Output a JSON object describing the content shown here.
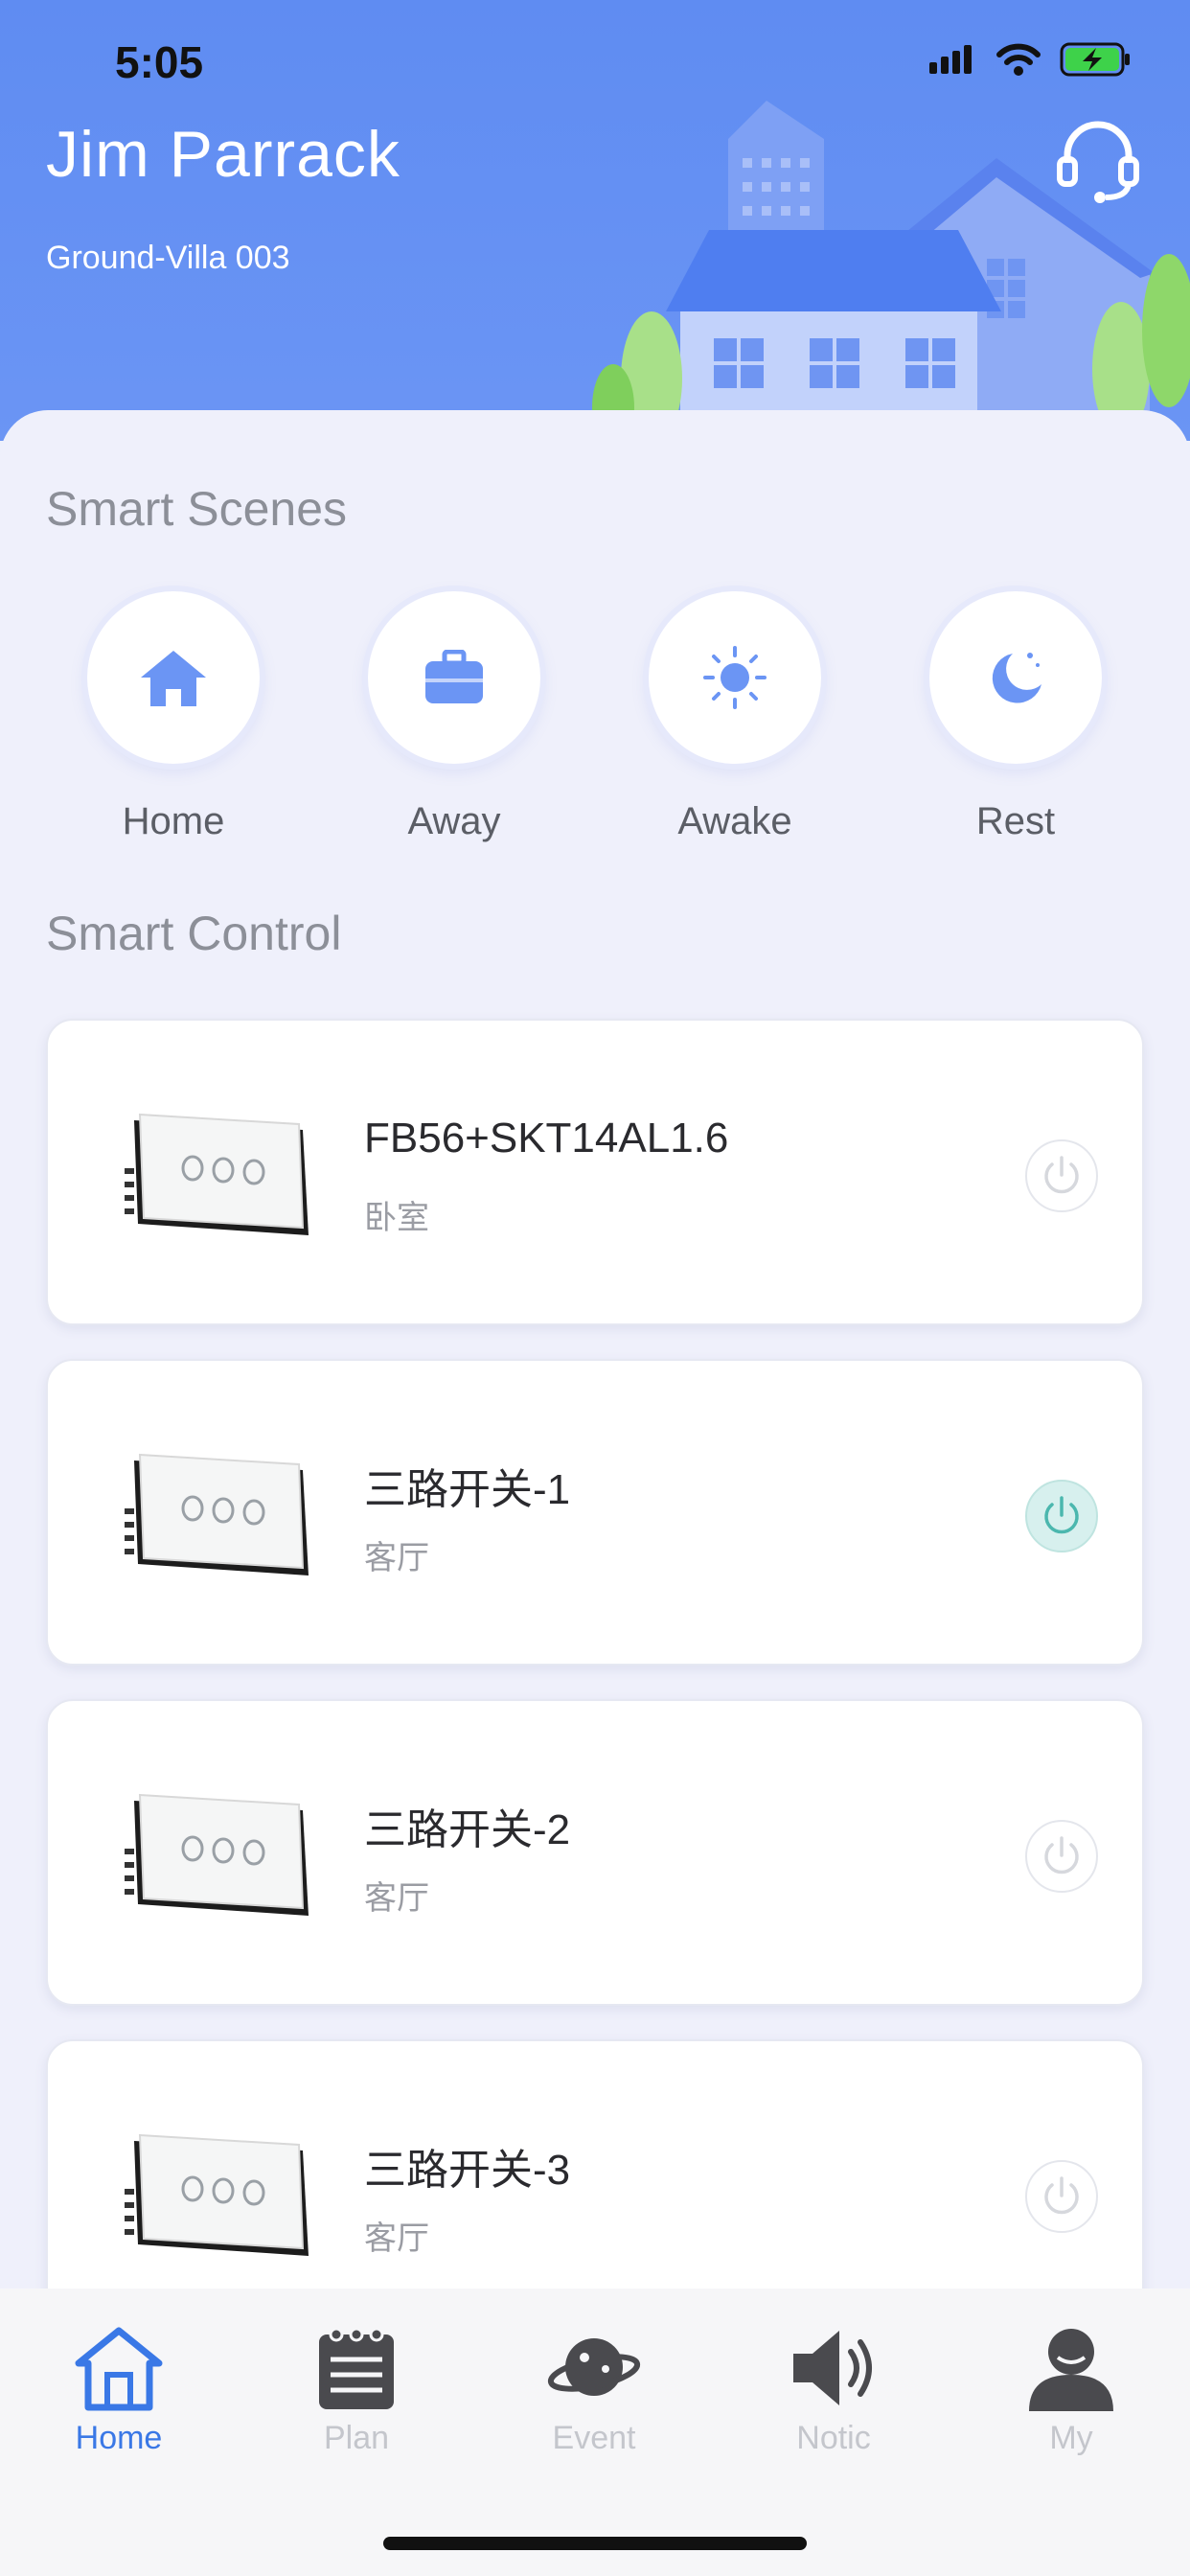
{
  "status_bar": {
    "time": "5:05"
  },
  "header": {
    "user_name": "Jim Parrack",
    "location": "Ground-Villa 003",
    "support_icon": "headset-icon"
  },
  "smart_scenes": {
    "title": "Smart Scenes",
    "items": [
      {
        "label": "Home",
        "icon": "home-icon"
      },
      {
        "label": "Away",
        "icon": "briefcase-icon"
      },
      {
        "label": "Awake",
        "icon": "sun-icon"
      },
      {
        "label": "Rest",
        "icon": "moon-icon"
      }
    ]
  },
  "smart_control": {
    "title": "Smart Control",
    "devices": [
      {
        "name": "FB56+SKT14AL1.6",
        "room": "卧室",
        "power_on": false
      },
      {
        "name": "三路开关-1",
        "room": "客厅",
        "power_on": true
      },
      {
        "name": "三路开关-2",
        "room": "客厅",
        "power_on": false
      },
      {
        "name": "三路开关-3",
        "room": "客厅",
        "power_on": false
      }
    ]
  },
  "tab_bar": {
    "items": [
      {
        "label": "Home",
        "icon": "home-outline-icon",
        "active": true
      },
      {
        "label": "Plan",
        "icon": "notepad-icon",
        "active": false
      },
      {
        "label": "Event",
        "icon": "planet-icon",
        "active": false
      },
      {
        "label": "Notic",
        "icon": "speaker-icon",
        "active": false
      },
      {
        "label": "My",
        "icon": "user-icon",
        "active": false
      }
    ]
  },
  "colors": {
    "header_blue": "#6b95f4",
    "accent_blue": "#3a78e6",
    "power_on_teal": "#4bb7ae",
    "scene_icon_blue": "#6b95f4"
  }
}
